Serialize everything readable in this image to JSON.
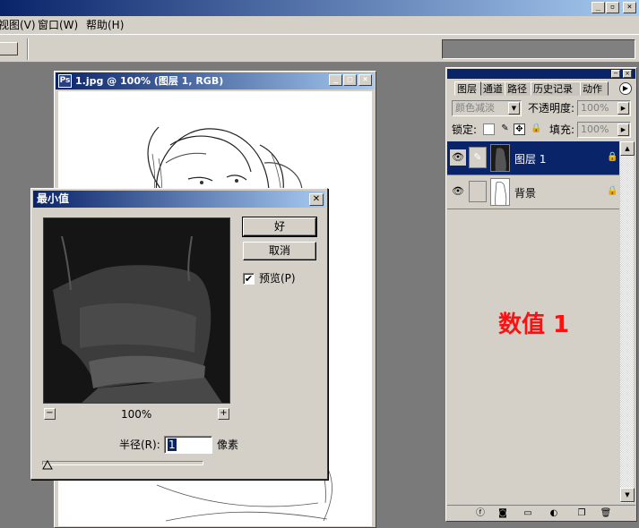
{
  "menubar": {
    "items": [
      "视图(V)",
      "窗口(W)",
      "帮助(H)"
    ]
  },
  "window_controls": [
    "_",
    "▫",
    "×"
  ],
  "document": {
    "title": "1.jpg @ 100% (图层 1, RGB)",
    "controls": [
      "_",
      "□",
      "×"
    ]
  },
  "dialog": {
    "title": "最小值",
    "ok_label": "好",
    "cancel_label": "取消",
    "preview_label": "预览(P)",
    "preview_checked": true,
    "zoom_minus": "−",
    "zoom_plus": "+",
    "zoom_level": "100%",
    "radius_label": "半径(R):",
    "radius_value": "1",
    "unit_label": "像素"
  },
  "layers_panel": {
    "tabs": [
      "图层",
      "通道",
      "路径",
      "历史记录",
      "动作"
    ],
    "blend_mode": "颜色减淡",
    "opacity_label": "不透明度:",
    "opacity_value": "100%",
    "lock_label": "锁定:",
    "fill_label": "填充:",
    "fill_value": "100%",
    "layers": [
      {
        "name": "图层 1",
        "selected": true
      },
      {
        "name": "背景",
        "selected": false
      }
    ],
    "annotation": "数值 1"
  },
  "colors": {
    "titlebar_start": "#0a246a",
    "titlebar_end": "#a6caf0",
    "panel_bg": "#d4d0c8",
    "annotation_red": "#ff1010"
  }
}
